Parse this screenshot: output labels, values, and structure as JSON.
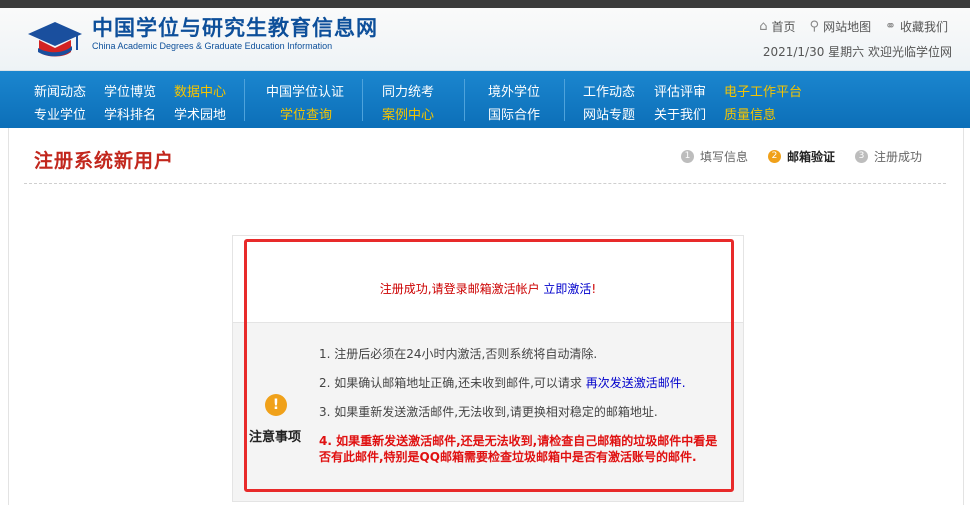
{
  "header": {
    "title": "中国学位与研究生教育信息网",
    "subtitle": "China Academic Degrees & Graduate Education Information",
    "links": [
      {
        "icon": "home-icon",
        "label": "首页"
      },
      {
        "icon": "map-pin-icon",
        "label": "网站地图"
      },
      {
        "icon": "link-icon",
        "label": "收藏我们"
      }
    ],
    "date_line": "2021/1/30 星期六  欢迎光临学位网"
  },
  "nav": {
    "row1": [
      "新闻动态",
      "学位博览",
      "数据中心",
      "中国学位认证",
      "同力统考",
      "境外学位",
      "工作动态",
      "评估评审",
      "电子工作平台"
    ],
    "row2": [
      "专业学位",
      "学科排名",
      "学术园地",
      "学位查询",
      "案例中心",
      "国际合作",
      "网站专题",
      "关于我们",
      "质量信息"
    ],
    "highlight_color": "#f5c400"
  },
  "page": {
    "title": "注册系统新用户",
    "steps": [
      {
        "num": "1",
        "label": "填写信息"
      },
      {
        "num": "2",
        "label": "邮箱验证"
      },
      {
        "num": "3",
        "label": "注册成功"
      }
    ]
  },
  "panel": {
    "success_text": "注册成功,请登录邮箱激活帐户",
    "activate_link": "立即激活",
    "exclaim": "!",
    "notice_label": "注意事项",
    "notice_icon": "!",
    "notes": {
      "n1": "1. 注册后必须在24小时内激活,否则系统将自动清除.",
      "n2_text": "2. 如果确认邮箱地址正确,还未收到邮件,可以请求 ",
      "n2_link": "再次发送激活邮件.",
      "n3": "3. 如果重新发送激活邮件,无法收到,请更换相对稳定的邮箱地址.",
      "n4": "4. 如果重新发送激活邮件,还是无法收到,请检查自己邮箱的垃圾邮件中看是否有此邮件,特别是QQ邮箱需要检查垃圾邮箱中是否有激活账号的邮件."
    }
  },
  "colors": {
    "brand_blue": "#0d4f9a",
    "nav_blue": "#0c6fb8",
    "title_red": "#c2271d",
    "highlight_box": "#e82a2a"
  }
}
